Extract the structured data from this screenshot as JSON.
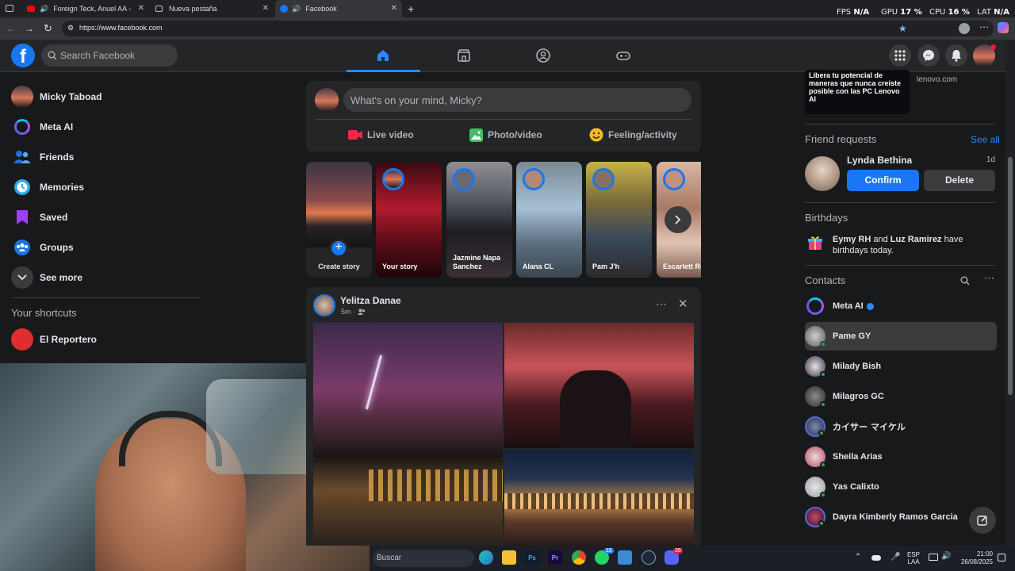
{
  "browser": {
    "tabs": [
      {
        "title": "Foreign Teck, Anuel AA - EL",
        "active": false
      },
      {
        "title": "Nueva pestaña",
        "active": false
      },
      {
        "title": "Facebook",
        "active": true
      }
    ],
    "new_tab_glyph": "+",
    "url": "https://www.facebook.com",
    "perf": {
      "fps_label": "FPS",
      "fps_value": "N/A",
      "gpu_label": "GPU",
      "gpu_value": "17 %",
      "cpu_label": "CPU",
      "cpu_value": "16 %",
      "lat_label": "LAT",
      "lat_value": "N/A"
    }
  },
  "header": {
    "logo": "f",
    "search_placeholder": "Search Facebook"
  },
  "sidebar": {
    "items": [
      {
        "label": "Micky Taboad",
        "icon": "profile-avatar"
      },
      {
        "label": "Meta AI",
        "icon": "meta-ai-icon"
      },
      {
        "label": "Friends",
        "icon": "friends-icon"
      },
      {
        "label": "Memories",
        "icon": "memories-icon"
      },
      {
        "label": "Saved",
        "icon": "saved-icon"
      },
      {
        "label": "Groups",
        "icon": "groups-icon"
      },
      {
        "label": "See more",
        "icon": "chevron-down-icon"
      }
    ],
    "shortcuts_title": "Your shortcuts",
    "shortcuts": [
      {
        "label": "El Reportero"
      }
    ]
  },
  "composer": {
    "placeholder": "What's on your mind, Micky?",
    "actions": [
      {
        "label": "Live video",
        "color": "#f02849"
      },
      {
        "label": "Photo/video",
        "color": "#45bd62"
      },
      {
        "label": "Feeling/activity",
        "color": "#f7b928"
      }
    ]
  },
  "stories": [
    {
      "name": "Create story"
    },
    {
      "name": "Your story"
    },
    {
      "name": "Jazmine Napa Sanchez"
    },
    {
      "name": "Alana CL"
    },
    {
      "name": "Pam J'h"
    },
    {
      "name": "Escarlett Ro"
    }
  ],
  "post": {
    "author": "Yelitza Danae",
    "time": "5m ·"
  },
  "right": {
    "ad_text": "Libera tu potencial de maneras que nunca creiste posible con las PC Lenovo AI",
    "ad_domain": "lenovo.com",
    "friend_requests_title": "Friend requests",
    "see_all": "See all",
    "request": {
      "name": "Lynda Bethina",
      "time": "1d",
      "confirm": "Confirm",
      "delete": "Delete"
    },
    "birthdays_title": "Birthdays",
    "birthday_names_1": "Eymy RH",
    "birthday_and": " and ",
    "birthday_names_2": "Luz Ramirez",
    "birthday_rest": " have birthdays today.",
    "contacts_title": "Contacts",
    "contacts": [
      {
        "name": "Meta AI",
        "online": false
      },
      {
        "name": "Pame GY",
        "online": true
      },
      {
        "name": "Milady Bish",
        "online": true
      },
      {
        "name": "Milagros GC",
        "online": true
      },
      {
        "name": "カイサー マイケル",
        "online": true
      },
      {
        "name": "Sheila Arias",
        "online": true
      },
      {
        "name": "Yas Calixto",
        "online": true
      },
      {
        "name": "Dayra Kimberly Ramos Garcia",
        "online": true
      }
    ]
  },
  "taskbar": {
    "search": "Buscar",
    "lang_1": "ESP",
    "lang_2": "LAA",
    "time": "21:00",
    "date": "26/08/2025",
    "ps_label": "Ps",
    "pr_label": "Pr",
    "whatsapp_badge": "12",
    "discord_badge": "28"
  }
}
